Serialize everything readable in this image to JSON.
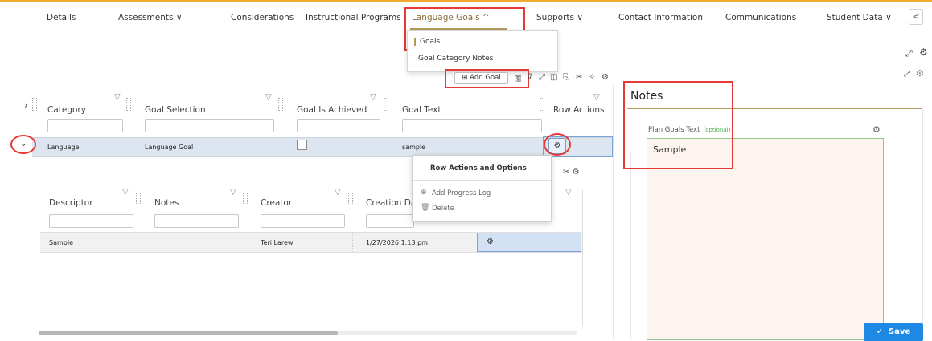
{
  "nav": {
    "items": [
      "Details",
      "Assessments",
      "Considerations",
      "Instructional Programs",
      "Language Goals",
      "Supports",
      "Contact Information",
      "Communications",
      "Student Data"
    ],
    "chevron_down": "∨",
    "chevron_up": "^",
    "back": "<"
  },
  "dropdown": {
    "goals": "Goals",
    "category_notes": "Goal Category Notes"
  },
  "toolbar": {
    "add_goal": "Add Goal"
  },
  "main_grid": {
    "headers": [
      "Category",
      "Goal Selection",
      "Goal Is Achieved",
      "Goal Text",
      "Row Actions"
    ],
    "row": {
      "category": "Language",
      "goal_selection": "Language Goal",
      "goal_is_achieved": false,
      "goal_text": "sample"
    }
  },
  "popup": {
    "title": "Row Actions and Options",
    "add_progress_log": "Add Progress Log",
    "delete": "Delete"
  },
  "sub_grid": {
    "headers": [
      "Descriptor",
      "Notes",
      "Creator",
      "Creation Dat"
    ],
    "row": {
      "descriptor": "Sample",
      "notes": "",
      "creator": "Teri Larew",
      "creation_date": "1/27/2026 1:13 pm"
    }
  },
  "notes_panel": {
    "title": "Notes",
    "label": "Plan Goals Text",
    "optional": "(optional)",
    "value": "Sample"
  },
  "save_label": "Save",
  "colors": {
    "accent": "#b39a5c",
    "annotation": "#e53935",
    "save": "#1e88e5"
  }
}
